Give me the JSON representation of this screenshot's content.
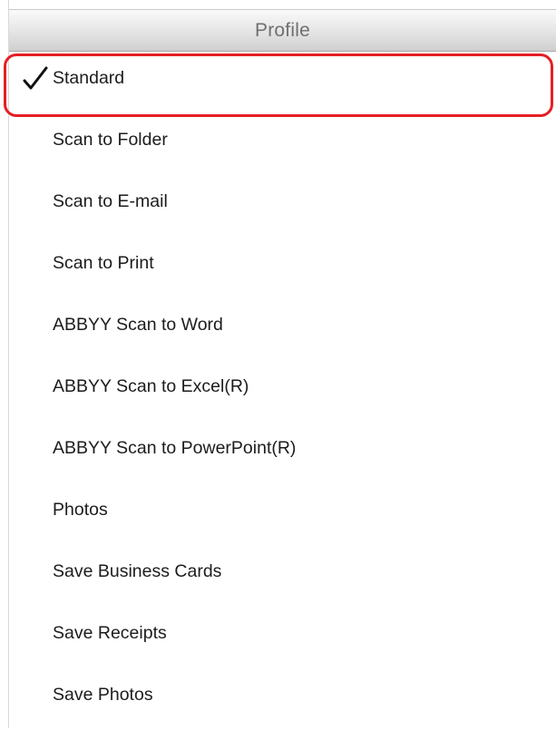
{
  "menu": {
    "header_title": "Profile",
    "selected_index": 0,
    "highlight_color": "#e41f25",
    "check_icon": "checkmark-icon",
    "items": [
      {
        "label": "Standard",
        "checked": true
      },
      {
        "label": "Scan to Folder",
        "checked": false
      },
      {
        "label": "Scan to E-mail",
        "checked": false
      },
      {
        "label": "Scan to Print",
        "checked": false
      },
      {
        "label": "ABBYY Scan to Word",
        "checked": false
      },
      {
        "label": "ABBYY Scan to Excel(R)",
        "checked": false
      },
      {
        "label": "ABBYY Scan to PowerPoint(R)",
        "checked": false
      },
      {
        "label": "Photos",
        "checked": false
      },
      {
        "label": "Save Business Cards",
        "checked": false
      },
      {
        "label": "Save Receipts",
        "checked": false
      },
      {
        "label": "Save Photos",
        "checked": false
      }
    ]
  }
}
